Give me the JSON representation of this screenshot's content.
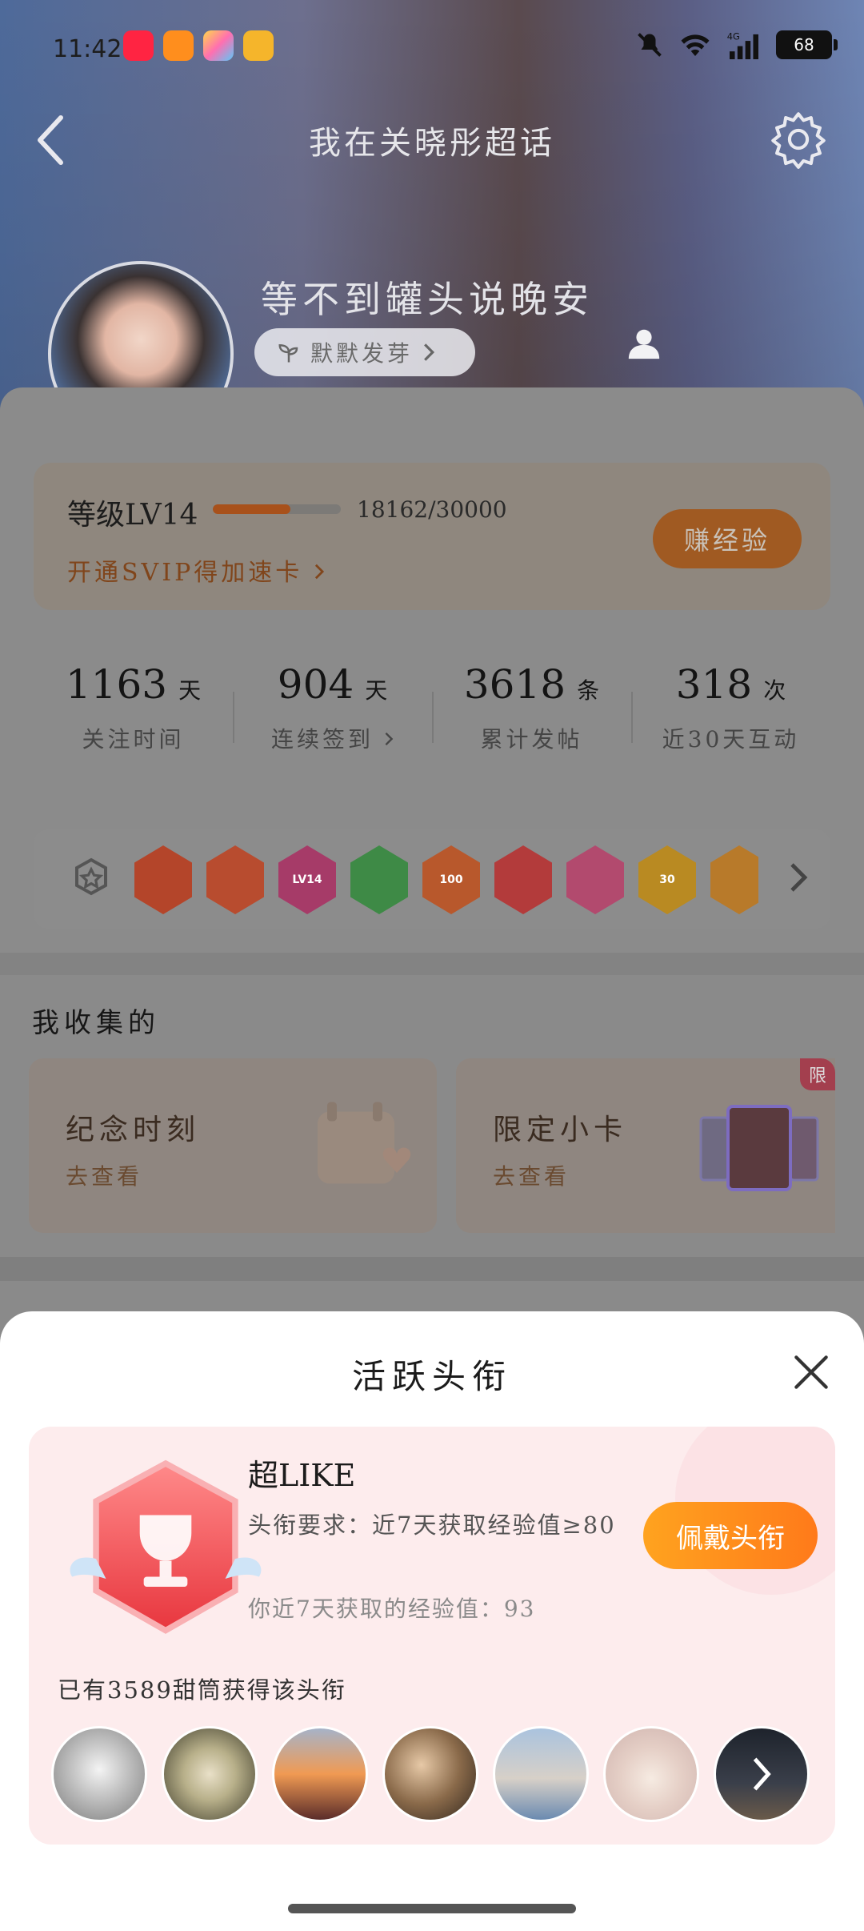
{
  "status_bar": {
    "time": "11:42",
    "battery": "68",
    "network": "4G",
    "app_icons": [
      "xiaohongshu-icon",
      "meituan-icon",
      "photos-app-icon",
      "weibo-icon"
    ]
  },
  "header": {
    "title": "我在关晓彤超话"
  },
  "profile": {
    "username": "等不到罐头说晚安",
    "tag_label": "默默发芽",
    "verified_badge": "V"
  },
  "level": {
    "label": "等级LV14",
    "progress_text": "18162/30000",
    "progress_value": 18162,
    "progress_max": 30000,
    "svip_link": "开通SVIP得加速卡",
    "earn_button": "赚经验"
  },
  "stats": [
    {
      "value": "1163",
      "unit": "天",
      "label": "关注时间"
    },
    {
      "value": "904",
      "unit": "天",
      "label": "连续签到"
    },
    {
      "value": "3618",
      "unit": "条",
      "label": "累计发帖"
    },
    {
      "value": "318",
      "unit": "次",
      "label": "近30天互动"
    }
  ],
  "badges": [
    {
      "name": "cat-badge",
      "color": "#b4452a",
      "text": ""
    },
    {
      "name": "cat-face-badge",
      "color": "#b84c2f",
      "text": ""
    },
    {
      "name": "lv14-badge",
      "color": "#a63b68",
      "text": "LV14"
    },
    {
      "name": "hand-badge",
      "color": "#3e8a46",
      "text": ""
    },
    {
      "name": "100-days-badge",
      "color": "#b8582c",
      "text": "100"
    },
    {
      "name": "trophy-badge",
      "color": "#b33b3b",
      "text": ""
    },
    {
      "name": "cap-badge",
      "color": "#b24a6e",
      "text": ""
    },
    {
      "name": "30-days-badge",
      "color": "#b98a22",
      "text": "30"
    },
    {
      "name": "partial-badge",
      "color": "#b87a2a",
      "text": ""
    }
  ],
  "collection": {
    "title": "我收集的",
    "tiles": [
      {
        "title": "纪念时刻",
        "sub": "去查看"
      },
      {
        "title": "限定小卡",
        "sub": "去查看",
        "tag": "限"
      }
    ]
  },
  "sheet": {
    "title": "活跃头衔",
    "honor_name": "超LIKE",
    "requirement": "头衔要求：近7天获取经验值≥80",
    "mine": "你近7天获取的经验值：93",
    "wear_button": "佩戴头衔",
    "owners_text": "已有3589甜筒获得该头衔"
  },
  "colors": {
    "accent": "#ff8a1f",
    "honor_card_bg": "#fdeced"
  }
}
